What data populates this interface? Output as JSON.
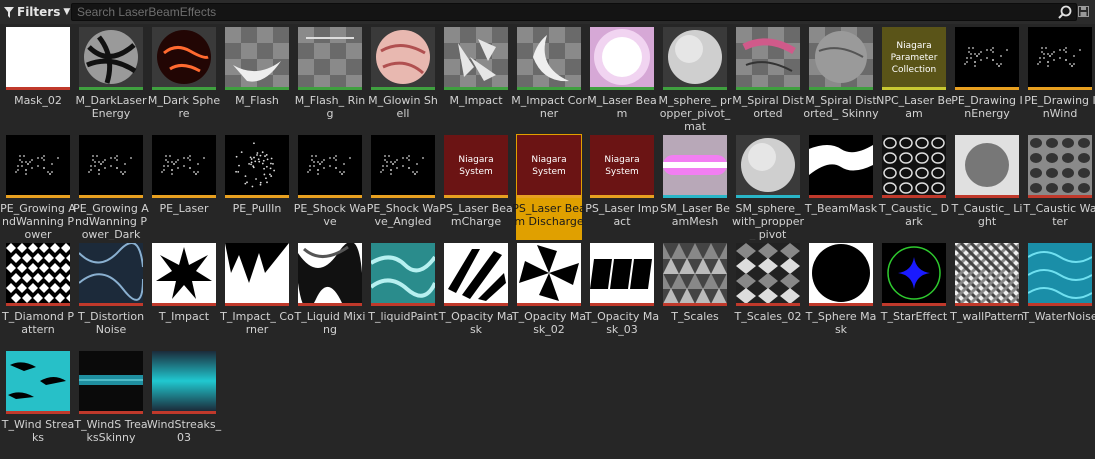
{
  "toolbar": {
    "filters_label": "Filters",
    "search_placeholder": "Search LaserBeamEffects"
  },
  "colors": {
    "texture": "#c0392b",
    "material": "#3fa03f",
    "niagara": "#e8a020",
    "mesh": "#29b6c8",
    "npc": "#c8c832"
  },
  "assets": [
    {
      "label": "Mask_02",
      "thumb": "white",
      "type": "texture"
    },
    {
      "label": "M_DarkLaser Energy",
      "thumb": "darksphere",
      "type": "material"
    },
    {
      "label": "M_Dark Sphere",
      "thumb": "firesphere",
      "type": "material"
    },
    {
      "label": "M_Flash",
      "thumb": "flash",
      "type": "material"
    },
    {
      "label": "M_Flash_ Ring",
      "thumb": "flashring",
      "type": "material"
    },
    {
      "label": "M_Glowin Shell",
      "thumb": "pinksphere",
      "type": "material"
    },
    {
      "label": "M_Impact",
      "thumb": "impact",
      "type": "material"
    },
    {
      "label": "M_Impact Corner",
      "thumb": "impactcorner",
      "type": "material"
    },
    {
      "label": "M_Laser Beam",
      "thumb": "glow",
      "type": "material"
    },
    {
      "label": "M_sphere_ propper_pivot_ mat",
      "thumb": "greysphere",
      "type": "material"
    },
    {
      "label": "M_Spiral Distorted",
      "thumb": "spiral",
      "type": "material"
    },
    {
      "label": "M_Spiral Distorted_ Skinny",
      "thumb": "spiral2",
      "type": "material"
    },
    {
      "label": "NPC_Laser Beam",
      "thumb": "npc",
      "type": "npc",
      "thumb_text": "Niagara Parameter Collection"
    },
    {
      "label": "PE_Drawing InEnergy",
      "thumb": "dots",
      "type": "niagara"
    },
    {
      "label": "PE_Drawing InWind",
      "thumb": "dots",
      "type": "niagara"
    },
    {
      "label": "PE_Growing AndWanning Power",
      "thumb": "dots",
      "type": "niagara"
    },
    {
      "label": "PE_Growing AndWanning Power_Dark",
      "thumb": "dots",
      "type": "niagara"
    },
    {
      "label": "PE_Laser",
      "thumb": "dots",
      "type": "niagara"
    },
    {
      "label": "PE_PullIn",
      "thumb": "burst",
      "type": "niagara"
    },
    {
      "label": "PE_Shock Wave",
      "thumb": "dots",
      "type": "niagara"
    },
    {
      "label": "PE_Shock Wave_Angled",
      "thumb": "dots",
      "type": "niagara"
    },
    {
      "label": "PS_Laser BeamCharge",
      "thumb": "nsys",
      "type": "niagara",
      "thumb_text": "Niagara System"
    },
    {
      "label": "PS_Laser Beam Discharge",
      "thumb": "nsys",
      "type": "niagara",
      "thumb_text": "Niagara System",
      "selected": true
    },
    {
      "label": "PS_Laser Impact",
      "thumb": "nsys",
      "type": "niagara",
      "thumb_text": "Niagara System"
    },
    {
      "label": "SM_Laser BeamMesh",
      "thumb": "beammesh",
      "type": "mesh"
    },
    {
      "label": "SM_sphere_ with_propper_ pivot",
      "thumb": "greysphere",
      "type": "mesh"
    },
    {
      "label": "T_BeamMask",
      "thumb": "beammask",
      "type": "texture"
    },
    {
      "label": "T_Caustic_ Dark",
      "thumb": "caustic",
      "type": "texture"
    },
    {
      "label": "T_Caustic_ Light",
      "thumb": "causticlight",
      "type": "texture"
    },
    {
      "label": "T_Caustic Water",
      "thumb": "causticwater",
      "type": "texture"
    },
    {
      "label": "T_Diamond Pattern",
      "thumb": "diamond",
      "type": "texture"
    },
    {
      "label": "T_Distortion Noise",
      "thumb": "distortion",
      "type": "texture"
    },
    {
      "label": "T_Impact",
      "thumb": "star",
      "type": "texture"
    },
    {
      "label": "T_Impact_ Corner",
      "thumb": "impactcornertex",
      "type": "texture"
    },
    {
      "label": "T_Liquid Mixing",
      "thumb": "liquid",
      "type": "texture"
    },
    {
      "label": "T_liquidPaint",
      "thumb": "liquidpaint",
      "type": "texture"
    },
    {
      "label": "T_Opacity Mask",
      "thumb": "stripes",
      "type": "texture"
    },
    {
      "label": "T_Opacity Mask_02",
      "thumb": "pinwheel",
      "type": "texture"
    },
    {
      "label": "T_Opacity Mask_03",
      "thumb": "bars",
      "type": "texture"
    },
    {
      "label": "T_Scales",
      "thumb": "scales",
      "type": "texture"
    },
    {
      "label": "T_Scales_02",
      "thumb": "scales2",
      "type": "texture"
    },
    {
      "label": "T_Sphere Mask",
      "thumb": "spheremask",
      "type": "texture"
    },
    {
      "label": "T_StarEffect",
      "thumb": "stareffect",
      "type": "texture"
    },
    {
      "label": "T_wallPattern",
      "thumb": "wall",
      "type": "texture"
    },
    {
      "label": "T_WaterNoise",
      "thumb": "water",
      "type": "texture"
    },
    {
      "label": "T_Wind Streaks",
      "thumb": "wind",
      "type": "texture"
    },
    {
      "label": "T_WindS TreaksSkinny",
      "thumb": "windskinny",
      "type": "texture"
    },
    {
      "label": "WindStreaks_ 03",
      "thumb": "gradient",
      "type": "texture"
    }
  ]
}
